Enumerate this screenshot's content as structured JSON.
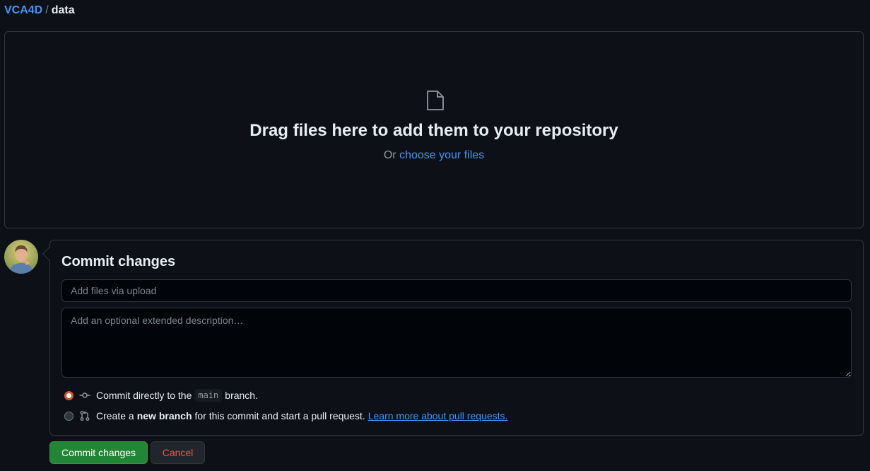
{
  "breadcrumb": {
    "repo": "VCA4D",
    "separator": "/",
    "directory": "data"
  },
  "dropzone": {
    "icon": "file-icon",
    "title": "Drag files here to add them to your repository",
    "or_text": "Or",
    "choose_link": "choose your files"
  },
  "commit": {
    "title": "Commit changes",
    "summary_placeholder": "Add files via upload",
    "description_placeholder": "Add an optional extended description…",
    "option_direct": {
      "prefix": "Commit directly to the",
      "branch": "main",
      "suffix": "branch.",
      "selected": true
    },
    "option_new_branch": {
      "prefix": "Create a",
      "bold": "new branch",
      "suffix": "for this commit and start a pull request.",
      "link": "Learn more about pull requests.",
      "selected": false
    }
  },
  "buttons": {
    "commit": "Commit changes",
    "cancel": "Cancel"
  },
  "colors": {
    "background": "#0d1117",
    "link": "#4493f8",
    "primary_button": "#238636",
    "danger": "#f85149",
    "radio_accent": "#d9542b"
  }
}
